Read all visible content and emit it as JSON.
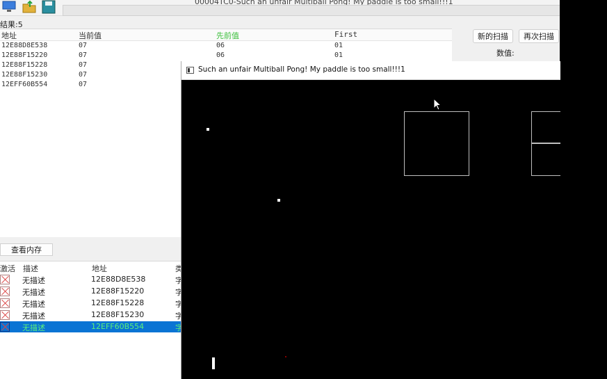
{
  "ce": {
    "window_title": "00004TC0-Such an unfair Multiball Pong!  My paddle is too small!!!1",
    "found_label": "结果:5",
    "results": {
      "headers": [
        "地址",
        "当前值",
        "先前值",
        "First"
      ],
      "rows": [
        [
          "12E88D8E538",
          "07",
          "06",
          "01"
        ],
        [
          "12E88F15220",
          "07",
          "06",
          "01"
        ],
        [
          "12E88F15228",
          "07",
          "",
          ""
        ],
        [
          "12E88F15230",
          "07",
          "",
          ""
        ],
        [
          "12EFF60B554",
          "07",
          "",
          ""
        ]
      ]
    },
    "new_scan_label": "新的扫描",
    "next_scan_label": "再次扫描",
    "value_label": "数值:",
    "memory_view_label": "查看内存",
    "address_list": {
      "headers": [
        "激活",
        "描述",
        "地址",
        "类"
      ],
      "rows": [
        {
          "desc": "无描述",
          "addr": "12E88D8E538",
          "type": "字"
        },
        {
          "desc": "无描述",
          "addr": "12E88F15220",
          "type": "字"
        },
        {
          "desc": "无描述",
          "addr": "12E88F15228",
          "type": "字"
        },
        {
          "desc": "无描述",
          "addr": "12E88F15230",
          "type": "字"
        },
        {
          "desc": "无描述",
          "addr": "12EFF60B554",
          "type": "字"
        }
      ]
    }
  },
  "pong": {
    "title": "Such an unfair Multiball Pong!  My paddle is too small!!!1"
  },
  "colors": {
    "selection": "#0a74d4",
    "selected_text": "#5cf07a",
    "previous_value_header": "#3bbf3b"
  }
}
